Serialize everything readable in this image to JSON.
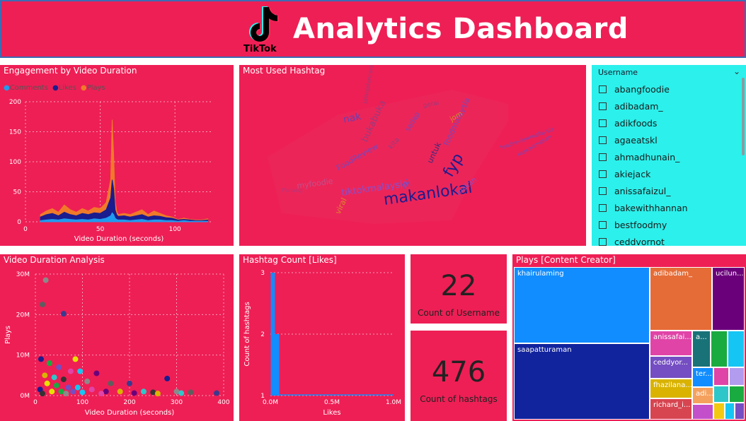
{
  "header": {
    "title": "Analytics Dashboard",
    "logo_text": "TikTok"
  },
  "colors": {
    "panel": "#ee1f55",
    "slicer": "#2cf0eb",
    "comments": "#1f9bf0",
    "likes": "#1b1c8e",
    "plays": "#f07a28"
  },
  "engagement": {
    "title": "Engagement by Video Duration",
    "legend": [
      "Comments",
      "Likes",
      "Plays"
    ],
    "chart_data": {
      "type": "area",
      "xlabel": "Video Duration (seconds)",
      "ylabel": "",
      "xlim": [
        0,
        125
      ],
      "ylim": [
        0,
        200
      ],
      "x_ticks": [
        "0",
        "50",
        "100"
      ],
      "y_ticks": [
        "0",
        "50",
        "100",
        "150",
        "200"
      ],
      "x": [
        10,
        14,
        18,
        22,
        26,
        30,
        34,
        38,
        42,
        46,
        50,
        54,
        57,
        58,
        59,
        60,
        61,
        62,
        66,
        70,
        74,
        78,
        82,
        86,
        90,
        94,
        98,
        102,
        106,
        110,
        114,
        118,
        122
      ],
      "series": [
        {
          "name": "Comments",
          "values": [
            2,
            3,
            4,
            3,
            5,
            4,
            3,
            4,
            3,
            5,
            4,
            6,
            10,
            15,
            12,
            6,
            4,
            3,
            3,
            2,
            3,
            4,
            2,
            3,
            3,
            2,
            2,
            1,
            2,
            1,
            1,
            1,
            1
          ]
        },
        {
          "name": "Likes",
          "values": [
            8,
            12,
            14,
            10,
            16,
            12,
            10,
            14,
            12,
            15,
            14,
            20,
            40,
            70,
            55,
            20,
            12,
            9,
            10,
            8,
            10,
            12,
            8,
            10,
            9,
            7,
            6,
            3,
            4,
            3,
            2,
            2,
            3
          ]
        },
        {
          "name": "Plays",
          "values": [
            12,
            18,
            22,
            16,
            28,
            20,
            16,
            22,
            18,
            24,
            22,
            32,
            70,
            170,
            110,
            34,
            18,
            12,
            14,
            12,
            16,
            20,
            12,
            18,
            14,
            10,
            8,
            4,
            6,
            4,
            3,
            3,
            5
          ]
        }
      ]
    }
  },
  "hashtag_cloud": {
    "title": "Most Used Hashtag",
    "words": [
      {
        "t": "makanlokal",
        "c": "#1b1c8e"
      },
      {
        "t": "fyp",
        "c": "#1b1c8e"
      },
      {
        "t": "tiktokmalaysia",
        "c": "#8a4fc9"
      },
      {
        "t": "myfoodie",
        "c": "#c0508a"
      },
      {
        "t": "FoodReview",
        "c": "#7a46b6"
      },
      {
        "t": "bukabuka",
        "c": "#9c3a7a"
      },
      {
        "t": "nak",
        "c": "#6b3fb0"
      },
      {
        "t": "ni",
        "c": "#7a46b6"
      },
      {
        "t": "untuk",
        "c": "#3a2a7a"
      },
      {
        "t": "foodmalaysia",
        "c": "#7a46b6"
      },
      {
        "t": "viral",
        "c": "#d98a2b"
      },
      {
        "t": "jalanjalancarimakan",
        "c": "#9c3a7a"
      },
      {
        "t": "foodreviewmalaysia",
        "c": "#7a46b6"
      },
      {
        "t": "Penang",
        "c": "#b7357a"
      },
      {
        "t": "makanmakan",
        "c": "#7a46b6"
      },
      {
        "t": "gerai",
        "c": "#9c3a7a"
      },
      {
        "t": "jom",
        "c": "#d98a2b"
      },
      {
        "t": "sedap",
        "c": "#7a46b6"
      },
      {
        "t": "makan",
        "c": "#8a4fc9"
      },
      {
        "t": "kita",
        "c": "#9c3a7a"
      }
    ]
  },
  "slicer": {
    "header": "Username",
    "items": [
      "abangfoodie",
      "adibadam_",
      "adikfoods",
      "agaeatskl",
      "ahmadhunain_",
      "akiejack",
      "anissafaizul_",
      "bakewithhannan",
      "bestfoodmy",
      "ceddvornot"
    ]
  },
  "duration_analysis": {
    "title": "Video Duration Analysis",
    "chart_data": {
      "type": "scatter",
      "xlabel": "Video Duration (seconds)",
      "ylabel": "Plays",
      "xlim": [
        0,
        400
      ],
      "ylim": [
        0,
        30
      ],
      "x_ticks": [
        "0",
        "100",
        "200",
        "300",
        "400"
      ],
      "y_ticks": [
        "0M",
        "10M",
        "20M",
        "30M"
      ],
      "points": [
        [
          22,
          28.5
        ],
        [
          15,
          22.5
        ],
        [
          60,
          20.2
        ],
        [
          12,
          9
        ],
        [
          85,
          9
        ],
        [
          30,
          8
        ],
        [
          50,
          7
        ],
        [
          95,
          6
        ],
        [
          75,
          6
        ],
        [
          130,
          5.5
        ],
        [
          20,
          5
        ],
        [
          40,
          4.5
        ],
        [
          60,
          4
        ],
        [
          110,
          3.5
        ],
        [
          160,
          3
        ],
        [
          200,
          3
        ],
        [
          280,
          4.2
        ],
        [
          25,
          3
        ],
        [
          45,
          2.5
        ],
        [
          70,
          2
        ],
        [
          90,
          2
        ],
        [
          120,
          1.5
        ],
        [
          150,
          1
        ],
        [
          180,
          1
        ],
        [
          230,
          1
        ],
        [
          250,
          0.8
        ],
        [
          300,
          1
        ],
        [
          330,
          0.8
        ],
        [
          385,
          0.6
        ],
        [
          10,
          1.5
        ],
        [
          35,
          1
        ],
        [
          55,
          1
        ],
        [
          80,
          1
        ],
        [
          100,
          0.8
        ],
        [
          140,
          0.5
        ],
        [
          210,
          0.6
        ],
        [
          260,
          0.5
        ],
        [
          310,
          0.6
        ],
        [
          15,
          0.5
        ],
        [
          65,
          0.5
        ]
      ]
    }
  },
  "hashtag_count": {
    "title": "Hashtag Count [Likes]",
    "chart_data": {
      "type": "bar",
      "xlabel": "Likes",
      "ylabel": "Count of hashtags",
      "xlim": [
        0,
        1.0
      ],
      "ylim": [
        1,
        3
      ],
      "x_ticks": [
        "0.0M",
        "0.5M",
        "1.0M"
      ],
      "y_ticks": [
        "1",
        "2",
        "3"
      ],
      "bars": [
        [
          0.01,
          3
        ],
        [
          0.015,
          3
        ],
        [
          0.02,
          3
        ],
        [
          0.025,
          3
        ],
        [
          0.03,
          3
        ],
        [
          0.035,
          2
        ],
        [
          0.045,
          2
        ],
        [
          0.055,
          2
        ],
        [
          0.065,
          2
        ],
        [
          0.075,
          1.02
        ],
        [
          0.2,
          1.01
        ],
        [
          0.5,
          1.01
        ],
        [
          0.9,
          1.01
        ]
      ]
    }
  },
  "card_users": {
    "value": "22",
    "label": "Count of Username"
  },
  "card_hashtags": {
    "value": "476",
    "label": "Count of hashtags"
  },
  "treemap": {
    "title": "Plays [Content Creator]",
    "tiles": [
      {
        "label": "khairulaming",
        "c": "#118dff"
      },
      {
        "label": "saapatturaman",
        "c": "#12239e"
      },
      {
        "label": "adibadam_",
        "c": "#e66c37"
      },
      {
        "label": "ucilun...",
        "c": "#6b007b"
      },
      {
        "label": "anissafai...",
        "c": "#e044a7"
      },
      {
        "label": "a...",
        "c": "#197278"
      },
      {
        "label": "",
        "c": "#1aab40"
      },
      {
        "label": "",
        "c": "#15c6f4"
      },
      {
        "label": "ceddyor...",
        "c": "#744ec2"
      },
      {
        "label": "fhazilana...",
        "c": "#d9b300"
      },
      {
        "label": "richard_i...",
        "c": "#d64550"
      },
      {
        "label": "ter...",
        "c": "#118dff"
      },
      {
        "label": "adi...",
        "c": "#f5a15e"
      },
      {
        "label": "",
        "c": "#e044a7"
      },
      {
        "label": "",
        "c": "#b19cf0"
      },
      {
        "label": "",
        "c": "#c34fcb"
      },
      {
        "label": "",
        "c": "#2ec7c9"
      },
      {
        "label": "",
        "c": "#1aab40"
      },
      {
        "label": "",
        "c": "#f2c811"
      },
      {
        "label": "",
        "c": "#15c6f4"
      },
      {
        "label": "",
        "c": "#744ec2"
      }
    ]
  }
}
